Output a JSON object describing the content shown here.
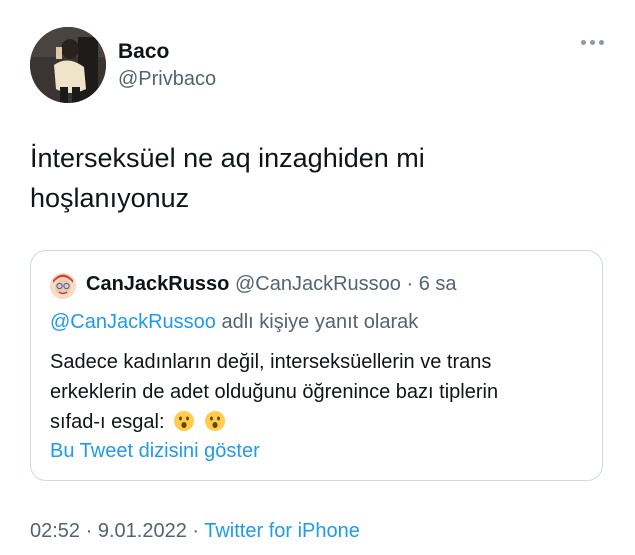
{
  "author": {
    "name": "Baco",
    "handle": "@Privbaco"
  },
  "tweet": {
    "line1": "İnterseksüel ne aq inzaghiden mi",
    "line2": "hoşlanıyonuz"
  },
  "quoted_tweet": {
    "name": "CanJackRusso",
    "handle": "@CanJackRussoo",
    "separator": " · ",
    "time": "6 sa",
    "reply_handle": "@CanJackRussoo",
    "reply_suffix": " adlı kişiye yanıt olarak",
    "body_line1": "Sadece kadınların değil, interseksüellerin ve trans",
    "body_line2": "erkeklerin de adet olduğunu öğrenince bazı tiplerin",
    "body_line3": "sıfad-ı esgal:",
    "emojis": [
      "astonished-face-emoji",
      "astonished-face-emoji"
    ],
    "show_thread": "Bu Tweet dizisini göster"
  },
  "footer": {
    "time": "02:52",
    "sep1": " · ",
    "date": "9.01.2022",
    "sep2": " · ",
    "source": "Twitter for iPhone"
  },
  "colors": {
    "text": "#0f1419",
    "secondary": "#536471",
    "link": "#1d9bf0",
    "border": "#cfd9de"
  }
}
